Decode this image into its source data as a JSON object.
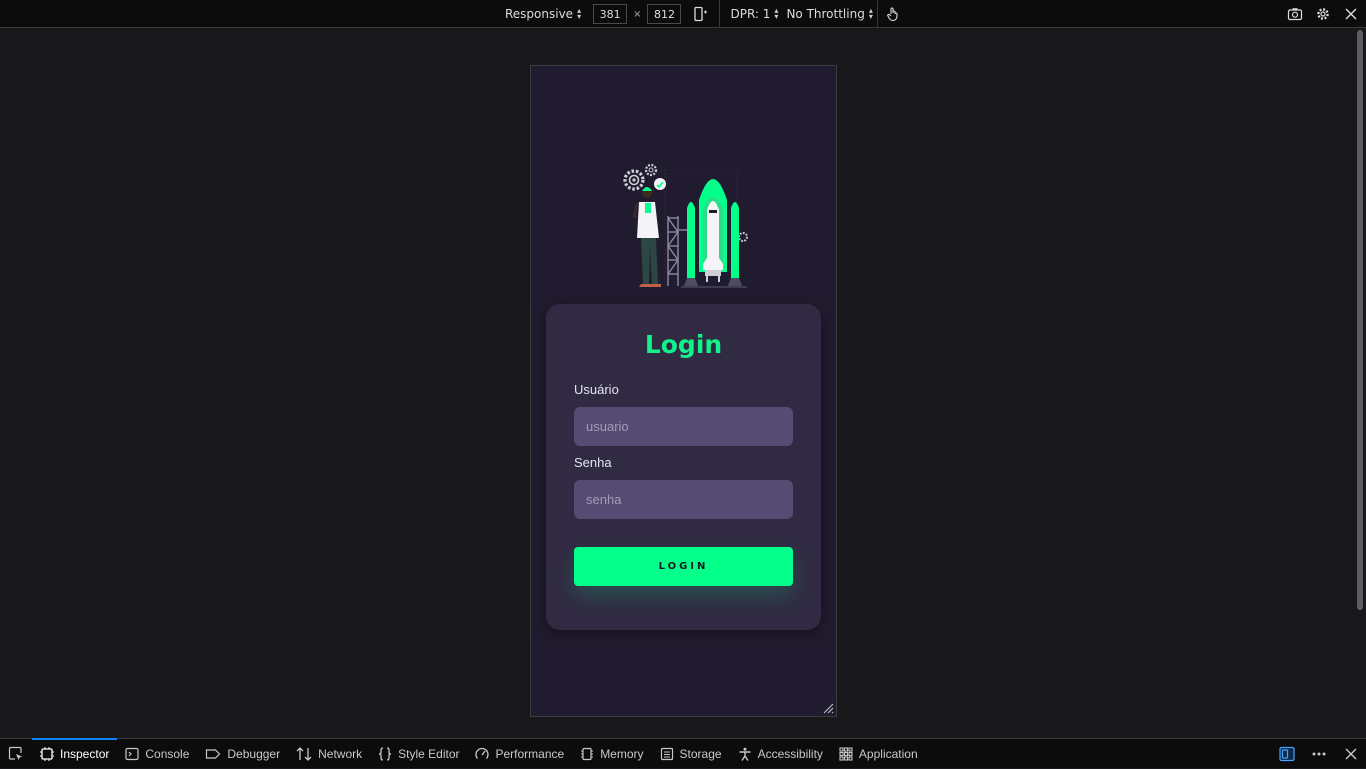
{
  "rdm": {
    "device": "Responsive",
    "width": "381",
    "times": "×",
    "height": "812",
    "dpr": "DPR: 1",
    "throttling": "No Throttling"
  },
  "page": {
    "title": "Login",
    "user_label": "Usuário",
    "user_placeholder": "usuario",
    "pass_label": "Senha",
    "pass_placeholder": "senha",
    "login_button": "LOGIN"
  },
  "devtools": {
    "tabs": [
      {
        "label": "Inspector",
        "icon": "inspector-icon"
      },
      {
        "label": "Console",
        "icon": "console-icon"
      },
      {
        "label": "Debugger",
        "icon": "debugger-icon"
      },
      {
        "label": "Network",
        "icon": "network-icon"
      },
      {
        "label": "Style Editor",
        "icon": "style-editor-icon"
      },
      {
        "label": "Performance",
        "icon": "performance-icon"
      },
      {
        "label": "Memory",
        "icon": "memory-icon"
      },
      {
        "label": "Storage",
        "icon": "storage-icon"
      },
      {
        "label": "Accessibility",
        "icon": "accessibility-icon"
      },
      {
        "label": "Application",
        "icon": "application-icon"
      }
    ]
  },
  "colors": {
    "accent": "#04ff8b",
    "title": "#12f28a",
    "card": "#312a43",
    "input": "#564b73",
    "page_bg": "#201b2e"
  }
}
